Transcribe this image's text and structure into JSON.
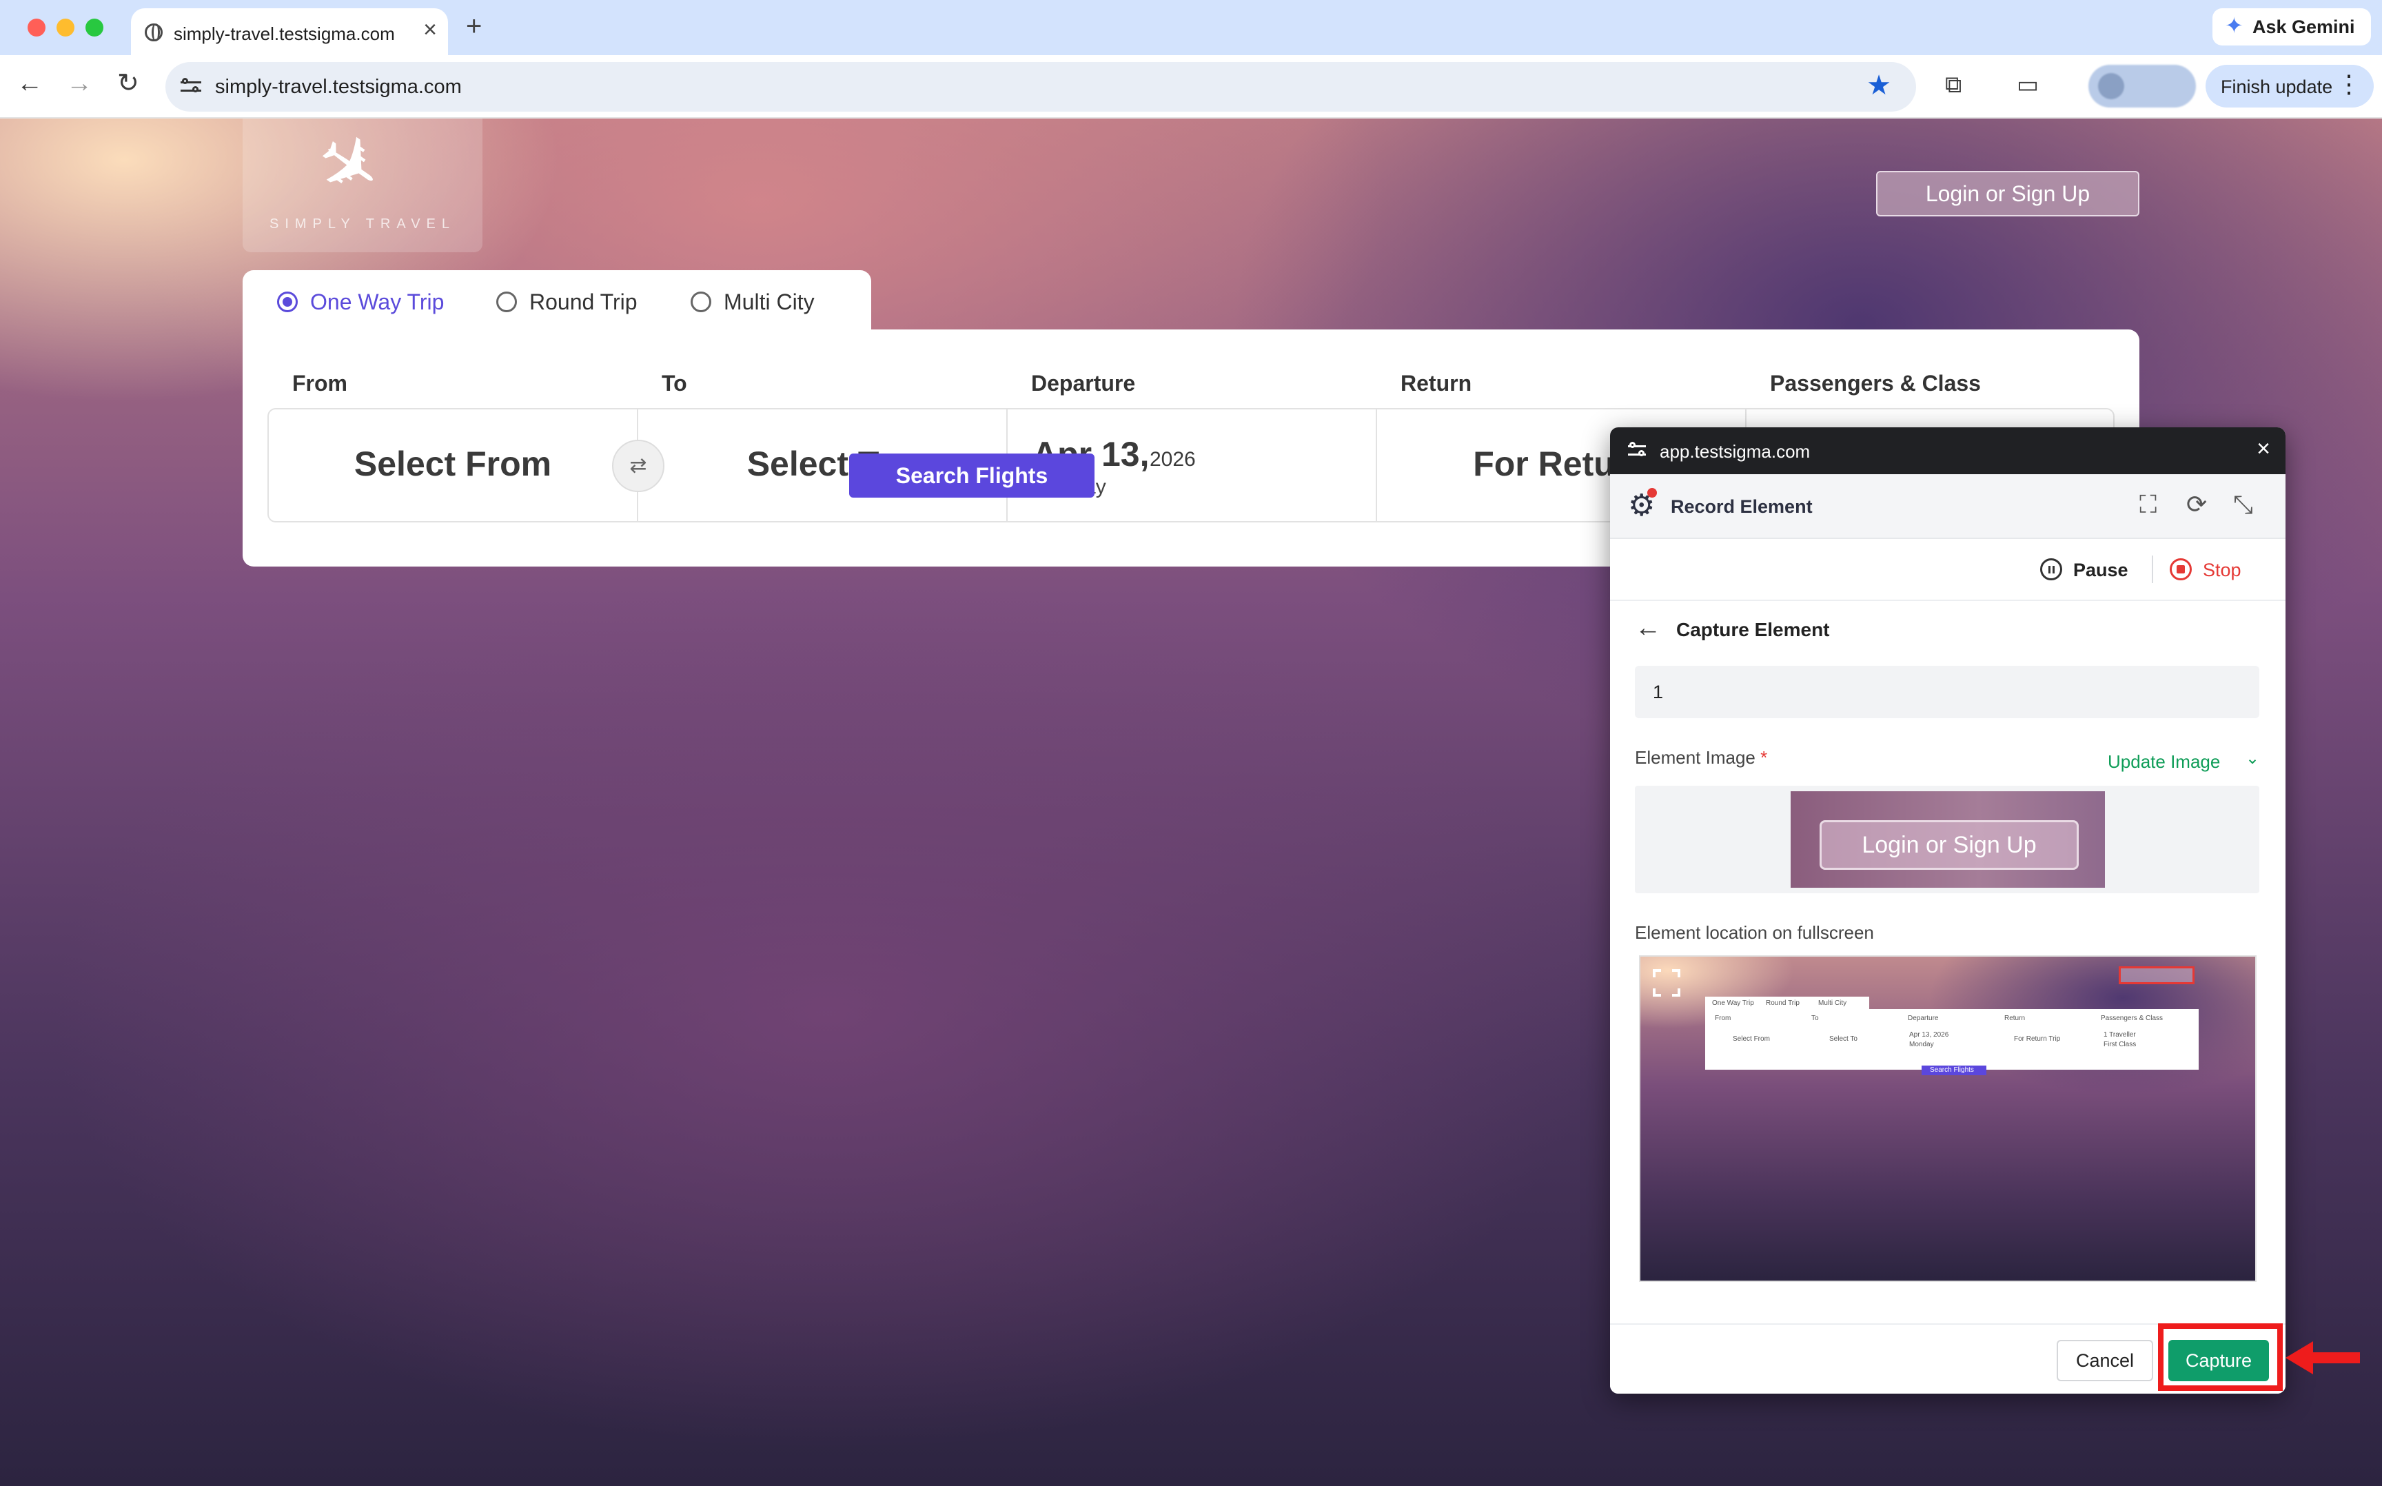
{
  "browser": {
    "tab_title": "simply-travel.testsigma.com",
    "tab_close": "×",
    "new_tab": "+",
    "ask_gemini": "Ask Gemini",
    "url": "simply-travel.testsigma.com",
    "finish_update": "Finish update",
    "icons": {
      "back": "←",
      "forward": "→",
      "reload": "↻",
      "bookmark": "★",
      "extensions": "⧉",
      "cast": "▭",
      "kebab": "⋮",
      "gemini": "✦"
    }
  },
  "site": {
    "logo_text": "SIMPLY TRAVEL",
    "logo_glyph": "✈",
    "login_button": "Login or Sign Up",
    "trip_types": [
      {
        "label": "One Way Trip",
        "selected": true
      },
      {
        "label": "Round Trip",
        "selected": false
      },
      {
        "label": "Multi City",
        "selected": false
      }
    ],
    "columns": {
      "from": "From",
      "to": "To",
      "departure": "Departure",
      "return": "Return",
      "passengers": "Passengers & Class"
    },
    "fields": {
      "from": "Select From",
      "swap": "⇄",
      "to": "Select To",
      "departure_date": "Apr 13,",
      "departure_year": "2026",
      "departure_day": "Monday",
      "return": "For Return"
    },
    "search_button": "Search Flights",
    "accent_color": "#5b47dd"
  },
  "recorder": {
    "window_url": "app.testsigma.com",
    "close": "×",
    "title": "Record Element",
    "header_icons": {
      "screen": "⛶",
      "refresh": "⟳",
      "minimize": "⤡"
    },
    "pause": "Pause",
    "stop": "Stop",
    "back": "←",
    "section_title": "Capture Element",
    "element_name": "1",
    "element_image_label": "Element Image",
    "required_mark": "*",
    "update_image": "Update Image",
    "update_chevron": "⌄",
    "thumbnail_text": "Login or Sign Up",
    "location_label": "Element location on fullscreen",
    "mini_preview": {
      "trip_types": [
        "One Way Trip",
        "Round Trip",
        "Multi City"
      ],
      "columns": [
        "From",
        "To",
        "Departure",
        "Return",
        "Passengers & Class"
      ],
      "fields": [
        "Select From",
        "Select To",
        "Apr 13, 2026",
        "Monday",
        "For Return Trip",
        "1 Traveller",
        "First Class"
      ],
      "search": "Search Flights",
      "login": "Login or Sign Up"
    },
    "cancel": "Cancel",
    "capture": "Capture",
    "capture_color": "#0f9d6a",
    "stop_color": "#e53935"
  },
  "annotation": {
    "highlight_color": "#ee1c1c"
  }
}
